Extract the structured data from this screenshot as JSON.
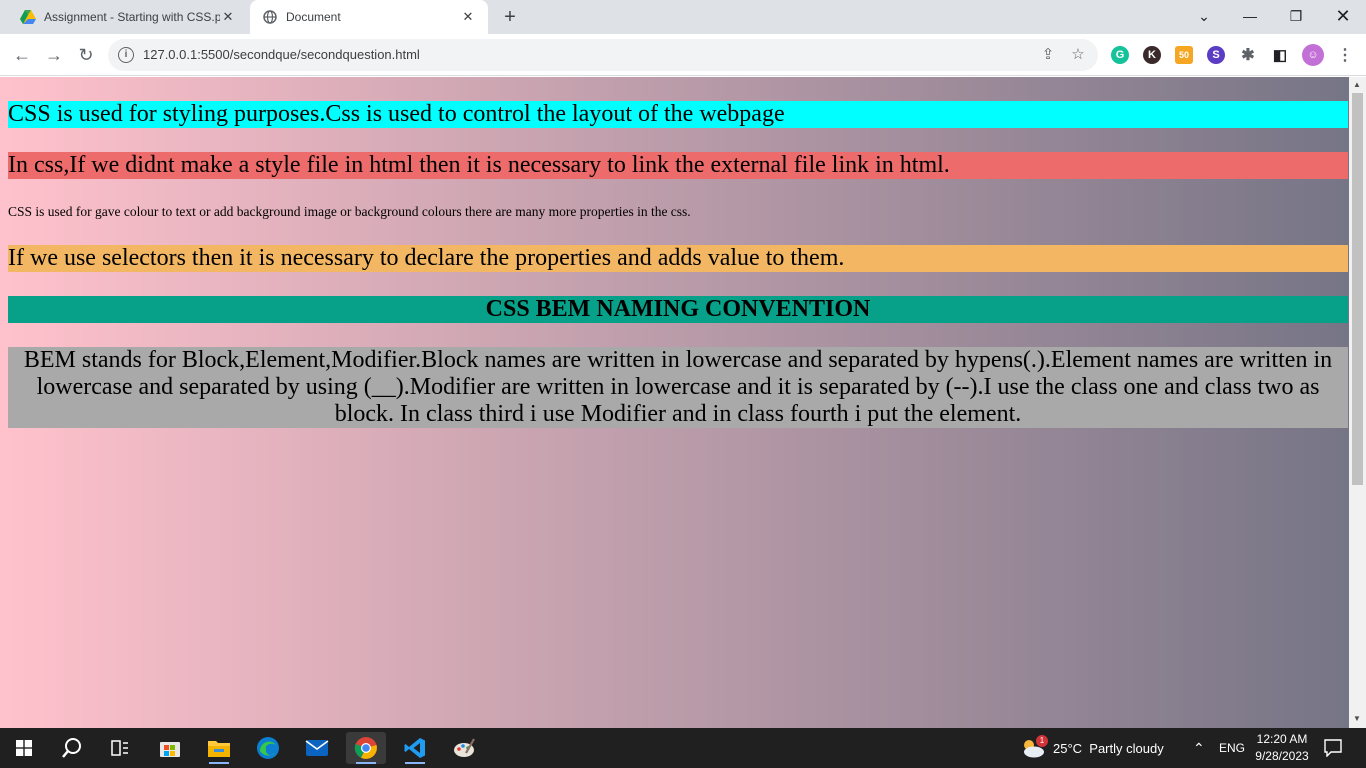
{
  "browser": {
    "tabs": [
      {
        "title": "Assignment - Starting with CSS.p",
        "favicon": "google-drive-icon",
        "active": false
      },
      {
        "title": "Document",
        "favicon": "globe-icon",
        "active": true
      }
    ],
    "url": "127.0.0.1:5500/secondque/secondquestion.html",
    "extensions": [
      {
        "name": "grammarly-icon",
        "letter": "G",
        "color": "#15c39a"
      },
      {
        "name": "k-extension-icon",
        "letter": "K",
        "color": "#3b2a2a"
      },
      {
        "name": "coupon-extension-icon",
        "letter": "50",
        "color": "#f5a623"
      },
      {
        "name": "s-extension-icon",
        "letter": "S",
        "color": "#5b3cc4"
      },
      {
        "name": "puzzle-icon",
        "letter": "✱",
        "color": "#5f6368"
      },
      {
        "name": "sidepanel-icon",
        "letter": "▢",
        "color": "#5f6368"
      },
      {
        "name": "profile-avatar-icon",
        "letter": "🐨",
        "color": "#c26fd6"
      }
    ]
  },
  "page": {
    "p1": "CSS is used for styling purposes.Css is used to control the layout of the webpage",
    "p2": "In css,If we didnt make a style file in html then it is necessary to link the external file link in html.",
    "p3": "CSS is used for gave colour to text or add background image or background colours there are many more properties in the css.",
    "p4": "If we use selectors then it is necessary to declare the properties and adds value to them.",
    "heading": "CSS BEM NAMING CONVENTION",
    "p6": "BEM stands for Block,Element,Modifier.Block names are written in lowercase and separated by hypens(.).Element names are written in lowercase and separated by using (__).Modifier are written in lowercase and it is separated by (--).I use the class one and class two as block. In class third i use Modifier and in class fourth i put the element.",
    "colors": {
      "p1": "#00ffff",
      "p2": "#ee6b6b",
      "p4": "#f3b764",
      "heading": "#07a088",
      "p6": "#a9a9a9",
      "gradient_start": "#ffc2cc",
      "gradient_end": "#767586"
    }
  },
  "taskbar": {
    "weather": "25°C  Partly cloudy",
    "weather_badge": "1",
    "language": "ENG",
    "time": "12:20 AM",
    "date": "9/28/2023",
    "apps": [
      "start-icon",
      "search-icon",
      "task-view-icon",
      "store-icon",
      "file-explorer-icon",
      "edge-icon",
      "mail-icon",
      "chrome-icon",
      "vscode-icon",
      "paint-icon"
    ]
  }
}
